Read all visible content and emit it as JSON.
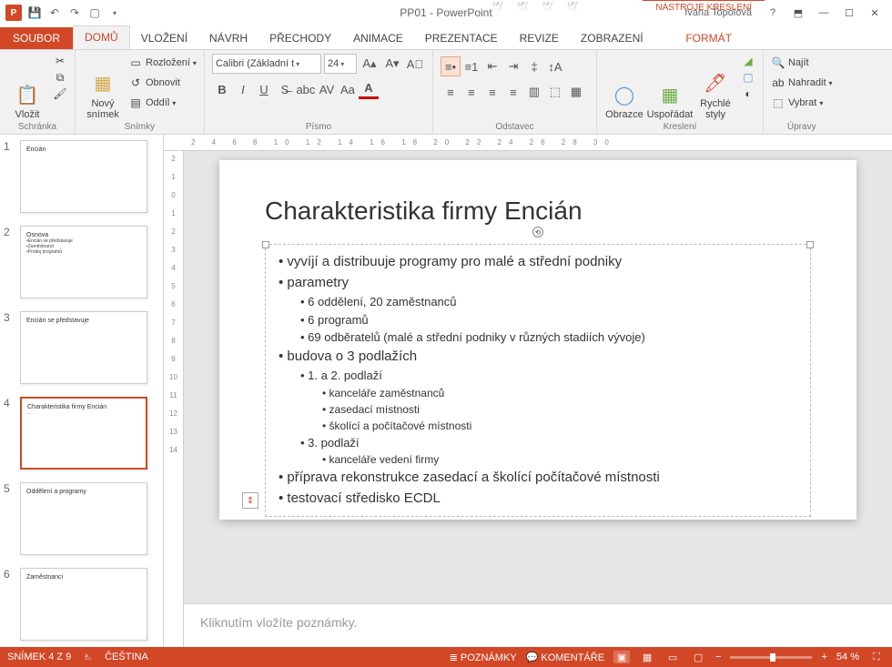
{
  "app": {
    "title": "PP01 - PowerPoint",
    "contextual_tab_title": "NÁSTROJE KRESLENÍ",
    "user": "Ivana Topolová"
  },
  "tabs": {
    "file": "SOUBOR",
    "items": [
      "DOMŮ",
      "VLOŽENÍ",
      "NÁVRH",
      "PŘECHODY",
      "ANIMACE",
      "PREZENTACE",
      "REVIZE",
      "ZOBRAZENÍ"
    ],
    "format": "FORMÁT",
    "active": "DOMŮ"
  },
  "ribbon": {
    "clipboard": {
      "label": "Schránka",
      "paste": "Vložit"
    },
    "slides": {
      "label": "Snímky",
      "new": "Nový\nsnímek",
      "layout": "Rozložení",
      "reset": "Obnovit",
      "section": "Oddíl"
    },
    "font": {
      "label": "Písmo",
      "name": "Calibri (Základní t",
      "size": "24"
    },
    "paragraph": {
      "label": "Odstavec"
    },
    "drawing": {
      "label": "Kreslení",
      "shapes": "Obrazce",
      "arrange": "Uspořádat",
      "styles": "Rychlé\nstyly"
    },
    "editing": {
      "label": "Úpravy",
      "find": "Najít",
      "replace": "Nahradit",
      "select": "Vybrat"
    }
  },
  "thumbs": [
    {
      "n": "1",
      "title": "Encián",
      "lines": []
    },
    {
      "n": "2",
      "title": "Osnova",
      "lines": [
        "•Encián se představuje",
        "•Zaměstnanci",
        "•Prodej programů"
      ]
    },
    {
      "n": "3",
      "title": "Encián se představuje",
      "lines": []
    },
    {
      "n": "4",
      "title": "Charakteristika firmy Encián",
      "lines": [
        "…"
      ],
      "selected": true
    },
    {
      "n": "5",
      "title": "Oddělení a programy",
      "lines": []
    },
    {
      "n": "6",
      "title": "Zaměstnanci",
      "lines": []
    }
  ],
  "slide": {
    "title": "Charakteristika firmy Encián",
    "bullets": [
      "vyvíjí a distribuuje programy pro malé a střední podniky",
      "parametry",
      [
        "6 oddělení, 20 zaměstnanců",
        "6 programů",
        "69 odběratelů (malé a střední podniky v různých stadiích vývoje)"
      ],
      "budova o 3 podlažích",
      [
        "1. a 2. podlaží",
        [
          "kanceláře zaměstnanců",
          "zasedací místnosti",
          "školící a počítačové místnosti"
        ],
        "3. podlaží",
        [
          "kanceláře vedení firmy"
        ]
      ],
      "příprava rekonstrukce zasedací a školící počítačové místnosti",
      "testovací středisko ECDL"
    ]
  },
  "notes": {
    "placeholder": "Kliknutím vložíte poznámky."
  },
  "status": {
    "slide_counter": "SNÍMEK 4 Z 9",
    "language": "ČEŠTINA",
    "notes_btn": "POZNÁMKY",
    "comments_btn": "KOMENTÁŘE",
    "zoom": "54 %"
  },
  "ruler": {
    "h": "2 4 6 8 10 12 14 16 18 20 22 24 26 28 30",
    "v": [
      "2",
      "1",
      "0",
      "1",
      "2",
      "3",
      "4",
      "5",
      "6",
      "7",
      "8",
      "9",
      "10",
      "11",
      "12",
      "13",
      "14"
    ]
  }
}
